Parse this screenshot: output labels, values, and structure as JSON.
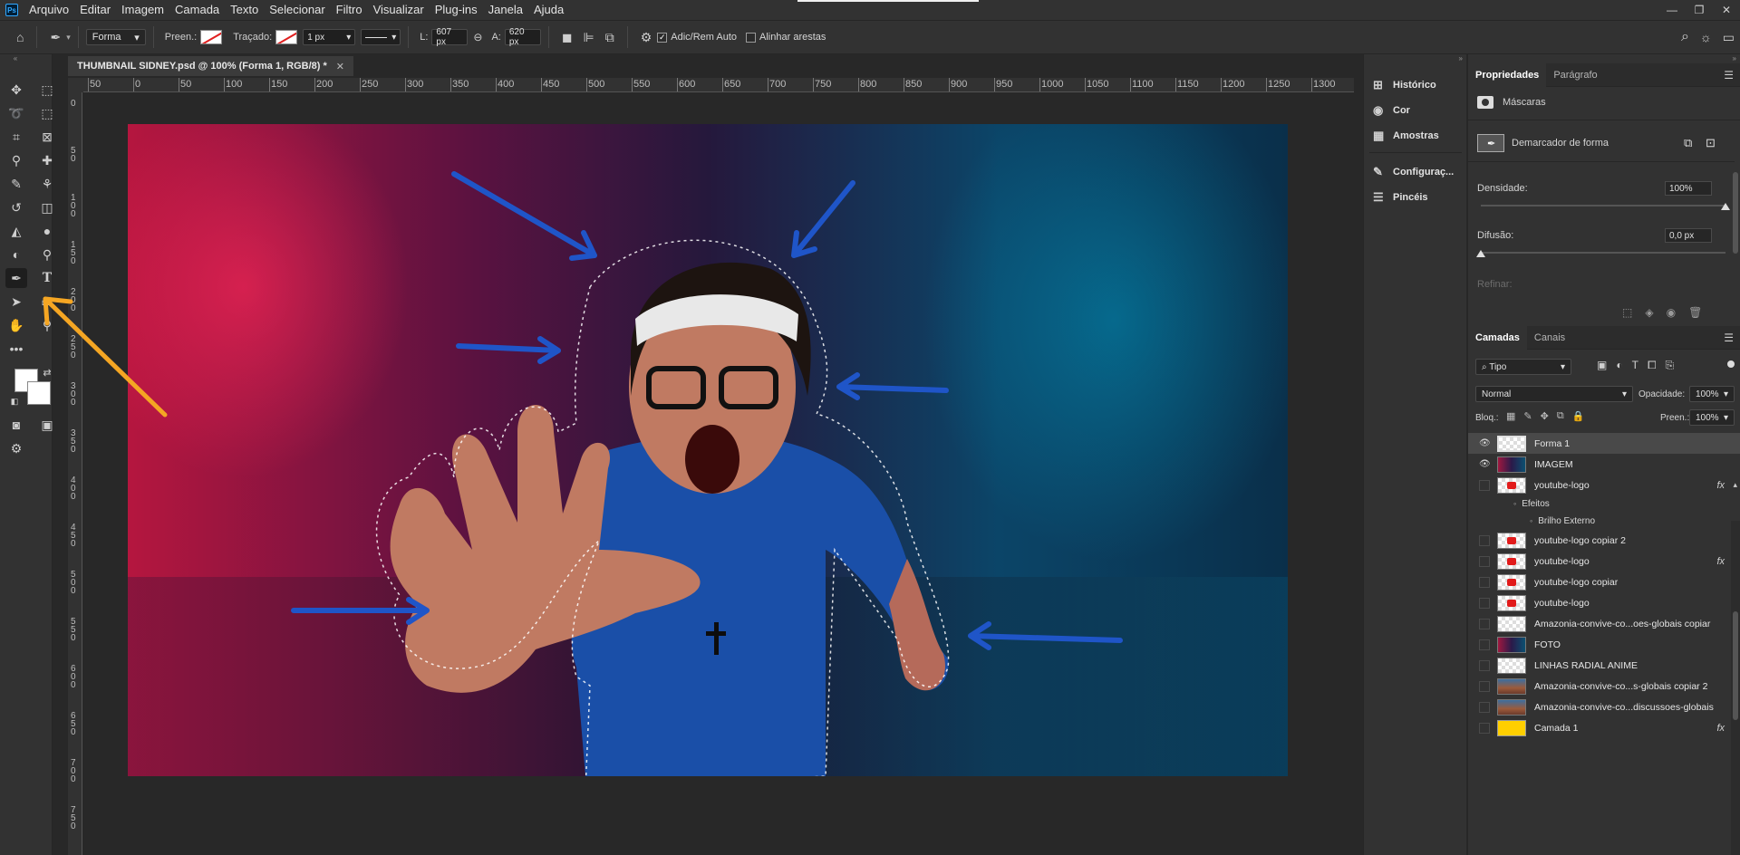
{
  "menubar": {
    "logo": "Ps",
    "items": [
      "Arquivo",
      "Editar",
      "Imagem",
      "Camada",
      "Texto",
      "Selecionar",
      "Filtro",
      "Visualizar",
      "Plug-ins",
      "Janela",
      "Ajuda"
    ]
  },
  "options": {
    "mode": "Forma",
    "fill_label": "Preen.:",
    "stroke_label": "Traçado:",
    "stroke_width": "1 px",
    "w_label": "L:",
    "w_value": "607 px",
    "h_label": "A:",
    "h_value": "620 px",
    "auto_add_label": "Adic/Rem Auto",
    "align_edges_label": "Alinhar arestas"
  },
  "document": {
    "tab_title": "THUMBNAIL SIDNEY.psd @ 100% (Forma 1, RGB/8) *"
  },
  "ruler": {
    "h_labels": [
      "50",
      "0",
      "50",
      "100",
      "150",
      "200",
      "250",
      "300",
      "350",
      "400",
      "450",
      "500",
      "550",
      "600",
      "650",
      "700",
      "750",
      "800",
      "850",
      "900",
      "950",
      "1000",
      "1050",
      "1100",
      "1150",
      "1200",
      "1250",
      "1300"
    ],
    "v_labels": [
      "0",
      "5\n0",
      "1\n0\n0",
      "1\n5\n0",
      "2\n0\n0",
      "2\n5\n0",
      "3\n0\n0",
      "3\n5\n0",
      "4\n0\n0",
      "4\n5\n0",
      "5\n0\n0",
      "5\n5\n0",
      "6\n0\n0",
      "6\n5\n0",
      "7\n0\n0",
      "7\n5\n0"
    ]
  },
  "narrow_panel": {
    "items": [
      "Histórico",
      "Cor",
      "Amostras",
      "Configuraç...",
      "Pincéis"
    ]
  },
  "properties": {
    "tabs": [
      "Propriedades",
      "Parágrafo"
    ],
    "masks_label": "Máscaras",
    "shape_mask_label": "Demarcador de forma",
    "density_label": "Densidade:",
    "density_value": "100%",
    "density_fraction": 1.0,
    "feather_label": "Difusão:",
    "feather_value": "0,0 px",
    "feather_fraction": 0.0,
    "refine_label": "Refinar:"
  },
  "layers": {
    "tabs": [
      "Camadas",
      "Canais"
    ],
    "filter_label": "Tipo",
    "blend_mode": "Normal",
    "opacity_label": "Opacidade:",
    "opacity_value": "100%",
    "lock_label": "Bloq.:",
    "fill_label": "Preen.:",
    "fill_value": "100%",
    "effects_label": "Efeitos",
    "outer_glow_label": "Brilho Externo",
    "fx_label": "fx",
    "items": [
      {
        "name": "Forma 1",
        "visible": true,
        "thumb": "forma",
        "fx": false
      },
      {
        "name": "IMAGEM",
        "visible": true,
        "thumb": "photo",
        "fx": false
      },
      {
        "name": "youtube-logo",
        "visible": false,
        "thumb": "red",
        "fx": true
      },
      {
        "name": "youtube-logo copiar 2",
        "visible": false,
        "thumb": "red",
        "fx": false
      },
      {
        "name": "youtube-logo",
        "visible": false,
        "thumb": "red",
        "fx": true
      },
      {
        "name": "youtube-logo copiar",
        "visible": false,
        "thumb": "red",
        "fx": false
      },
      {
        "name": "youtube-logo",
        "visible": false,
        "thumb": "red",
        "fx": false
      },
      {
        "name": "Amazonia-convive-co...oes-globais copiar",
        "visible": false,
        "thumb": "blank",
        "fx": false
      },
      {
        "name": "FOTO",
        "visible": false,
        "thumb": "photo",
        "fx": false
      },
      {
        "name": "LINHAS RADIAL ANIME",
        "visible": false,
        "thumb": "blank",
        "fx": false
      },
      {
        "name": "Amazonia-convive-co...s-globais copiar 2",
        "visible": false,
        "thumb": "crowd",
        "fx": false
      },
      {
        "name": "Amazonia-convive-co...discussoes-globais",
        "visible": false,
        "thumb": "crowd",
        "fx": false
      },
      {
        "name": "Camada 1",
        "visible": false,
        "thumb": "yellow",
        "fx": true
      }
    ]
  },
  "colors": {
    "accent_blue": "#1f55c8",
    "arrow_orange": "#f5a623",
    "youtube_red": "#e21b1b",
    "layer_yellow": "#ffcf00"
  }
}
